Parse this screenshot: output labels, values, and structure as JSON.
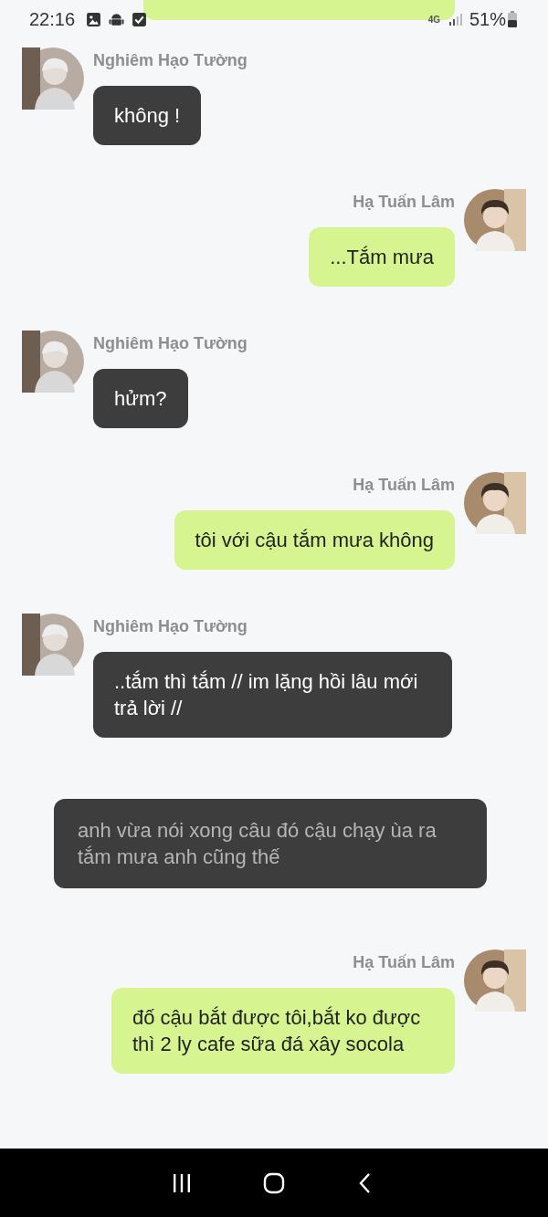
{
  "status_bar": {
    "time": "22:16",
    "network": "4G",
    "battery": "51%"
  },
  "messages": [
    {
      "kind": "incoming",
      "sender": "Nghiêm Hạo Tường",
      "text": "không !"
    },
    {
      "kind": "outgoing",
      "sender": "Hạ Tuấn Lâm",
      "text": "...Tắm mưa"
    },
    {
      "kind": "incoming",
      "sender": "Nghiêm Hạo Tường",
      "text": "hửm?"
    },
    {
      "kind": "outgoing",
      "sender": "Hạ Tuấn Lâm",
      "text": "tôi với cậu tắm mưa không"
    },
    {
      "kind": "incoming",
      "sender": "Nghiêm Hạo Tường",
      "text": "..tắm thì tắm // im lặng hồi lâu mới trả lời //"
    },
    {
      "kind": "narration",
      "text": "anh vừa nói xong câu đó cậu chạy ùa ra tắm mưa anh cũng thế"
    },
    {
      "kind": "outgoing",
      "sender": "Hạ Tuấn Lâm",
      "text": "đố cậu bắt được tôi,bắt ko được thì 2 ly cafe sữa đá xây socola"
    }
  ]
}
